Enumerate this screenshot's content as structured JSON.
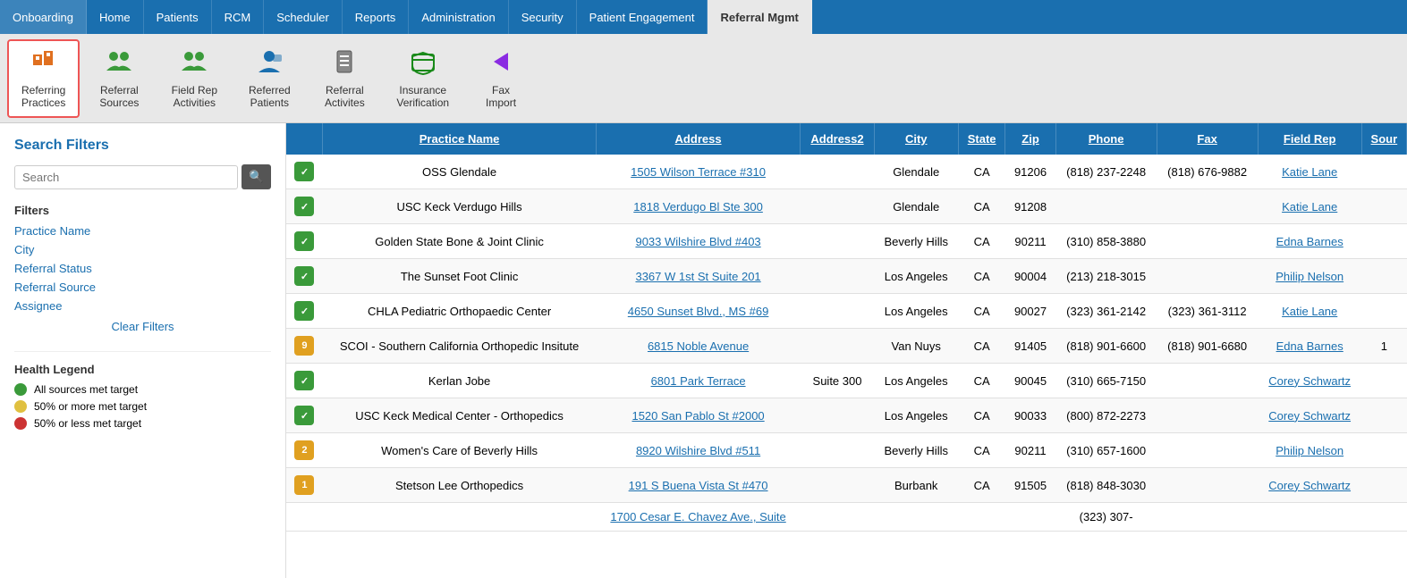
{
  "topNav": {
    "items": [
      {
        "label": "Onboarding",
        "active": false
      },
      {
        "label": "Home",
        "active": false
      },
      {
        "label": "Patients",
        "active": false
      },
      {
        "label": "RCM",
        "active": false
      },
      {
        "label": "Scheduler",
        "active": false
      },
      {
        "label": "Reports",
        "active": false
      },
      {
        "label": "Administration",
        "active": false
      },
      {
        "label": "Security",
        "active": false
      },
      {
        "label": "Patient Engagement",
        "active": false
      },
      {
        "label": "Referral Mgmt",
        "active": true
      }
    ]
  },
  "toolbar": {
    "items": [
      {
        "label": "Referring\nPractices",
        "icon": "🏢",
        "iconClass": "icon-referring",
        "active": true,
        "name": "referring-practices"
      },
      {
        "label": "Referral\nSources",
        "icon": "👥",
        "iconClass": "icon-referral-sources",
        "active": false,
        "name": "referral-sources"
      },
      {
        "label": "Field Rep\nActivities",
        "icon": "👥",
        "iconClass": "icon-field-rep",
        "active": false,
        "name": "field-rep-activities"
      },
      {
        "label": "Referred\nPatients",
        "icon": "👤",
        "iconClass": "icon-referred-patients",
        "active": false,
        "name": "referred-patients"
      },
      {
        "label": "Referral\nActivites",
        "icon": "📋",
        "iconClass": "icon-referral-activities",
        "active": false,
        "name": "referral-activites"
      },
      {
        "label": "Insurance\nVerification",
        "icon": "🏥",
        "iconClass": "icon-insurance",
        "active": false,
        "name": "insurance-verification"
      },
      {
        "label": "Fax\nImport",
        "icon": "➤",
        "iconClass": "icon-fax",
        "active": false,
        "name": "fax-import"
      }
    ]
  },
  "sidebar": {
    "title": "Search Filters",
    "searchPlaceholder": "Search",
    "filtersLabel": "Filters",
    "filters": [
      {
        "label": "Practice Name",
        "name": "filter-practice-name"
      },
      {
        "label": "City",
        "name": "filter-city"
      },
      {
        "label": "Referral Status",
        "name": "filter-referral-status"
      },
      {
        "label": "Referral Source",
        "name": "filter-referral-source"
      },
      {
        "label": "Assignee",
        "name": "filter-assignee"
      }
    ],
    "clearFilters": "Clear Filters",
    "healthLegend": {
      "title": "Health Legend",
      "items": [
        {
          "color": "#3a9a3a",
          "label": "All sources met target"
        },
        {
          "color": "#e0c040",
          "label": "50% or more met target"
        },
        {
          "color": "#cc3333",
          "label": "50% or less met target"
        }
      ]
    }
  },
  "table": {
    "columns": [
      {
        "label": "",
        "key": "badge"
      },
      {
        "label": "Practice Name",
        "key": "practiceName"
      },
      {
        "label": "Address",
        "key": "address"
      },
      {
        "label": "Address2",
        "key": "address2"
      },
      {
        "label": "City",
        "key": "city"
      },
      {
        "label": "State",
        "key": "state"
      },
      {
        "label": "Zip",
        "key": "zip"
      },
      {
        "label": "Phone",
        "key": "phone"
      },
      {
        "label": "Fax",
        "key": "fax"
      },
      {
        "label": "Field Rep",
        "key": "fieldRep"
      },
      {
        "label": "Sour",
        "key": "source"
      }
    ],
    "rows": [
      {
        "badge": "✓",
        "badgeType": "green",
        "practiceName": "OSS Glendale",
        "address": "1505 Wilson Terrace #310",
        "address2": "",
        "city": "Glendale",
        "state": "CA",
        "zip": "91206",
        "phone": "(818) 237-2248",
        "fax": "(818) 676-9882",
        "fieldRep": "Katie Lane",
        "source": ""
      },
      {
        "badge": "✓",
        "badgeType": "green",
        "practiceName": "USC Keck Verdugo Hills",
        "address": "1818 Verdugo Bl Ste 300",
        "address2": "",
        "city": "Glendale",
        "state": "CA",
        "zip": "91208",
        "phone": "",
        "fax": "",
        "fieldRep": "Katie Lane",
        "source": ""
      },
      {
        "badge": "✓",
        "badgeType": "green",
        "practiceName": "Golden State Bone & Joint Clinic",
        "address": "9033 Wilshire Blvd #403",
        "address2": "",
        "city": "Beverly Hills",
        "state": "CA",
        "zip": "90211",
        "phone": "(310) 858-3880",
        "fax": "",
        "fieldRep": "Edna Barnes",
        "source": ""
      },
      {
        "badge": "✓",
        "badgeType": "green",
        "practiceName": "The Sunset Foot Clinic",
        "address": "3367 W 1st St Suite 201",
        "address2": "",
        "city": "Los Angeles",
        "state": "CA",
        "zip": "90004",
        "phone": "(213) 218-3015",
        "fax": "",
        "fieldRep": "Philip Nelson",
        "source": ""
      },
      {
        "badge": "✓",
        "badgeType": "green",
        "practiceName": "CHLA Pediatric Orthopaedic Center",
        "address": "4650 Sunset Blvd., MS #69",
        "address2": "",
        "city": "Los Angeles",
        "state": "CA",
        "zip": "90027",
        "phone": "(323) 361-2142",
        "fax": "(323) 361-3112",
        "fieldRep": "Katie Lane",
        "source": ""
      },
      {
        "badge": "9",
        "badgeType": "yellow",
        "practiceName": "SCOI - Southern California Orthopedic Insitute",
        "address": "6815 Noble Avenue",
        "address2": "",
        "city": "Van Nuys",
        "state": "CA",
        "zip": "91405",
        "phone": "(818) 901-6600",
        "fax": "(818) 901-6680",
        "fieldRep": "Edna Barnes",
        "source": "1"
      },
      {
        "badge": "✓",
        "badgeType": "green",
        "practiceName": "Kerlan Jobe",
        "address": "6801 Park Terrace",
        "address2": "Suite 300",
        "city": "Los Angeles",
        "state": "CA",
        "zip": "90045",
        "phone": "(310) 665-7150",
        "fax": "",
        "fieldRep": "Corey Schwartz",
        "source": ""
      },
      {
        "badge": "✓",
        "badgeType": "green",
        "practiceName": "USC Keck Medical Center - Orthopedics",
        "address": "1520 San Pablo St #2000",
        "address2": "",
        "city": "Los Angeles",
        "state": "CA",
        "zip": "90033",
        "phone": "(800) 872-2273",
        "fax": "",
        "fieldRep": "Corey Schwartz",
        "source": ""
      },
      {
        "badge": "2",
        "badgeType": "yellow",
        "practiceName": "Women's Care of Beverly Hills",
        "address": "8920 Wilshire Blvd #511",
        "address2": "",
        "city": "Beverly Hills",
        "state": "CA",
        "zip": "90211",
        "phone": "(310) 657-1600",
        "fax": "",
        "fieldRep": "Philip Nelson",
        "source": ""
      },
      {
        "badge": "1",
        "badgeType": "yellow",
        "practiceName": "Stetson Lee Orthopedics",
        "address": "191 S Buena Vista St #470",
        "address2": "",
        "city": "Burbank",
        "state": "CA",
        "zip": "91505",
        "phone": "(818) 848-3030",
        "fax": "",
        "fieldRep": "Corey Schwartz",
        "source": ""
      },
      {
        "badge": "",
        "badgeType": "",
        "practiceName": "",
        "address": "1700 Cesar E. Chavez Ave., Suite",
        "address2": "",
        "city": "",
        "state": "",
        "zip": "",
        "phone": "(323) 307-",
        "fax": "",
        "fieldRep": "",
        "source": ""
      }
    ]
  }
}
